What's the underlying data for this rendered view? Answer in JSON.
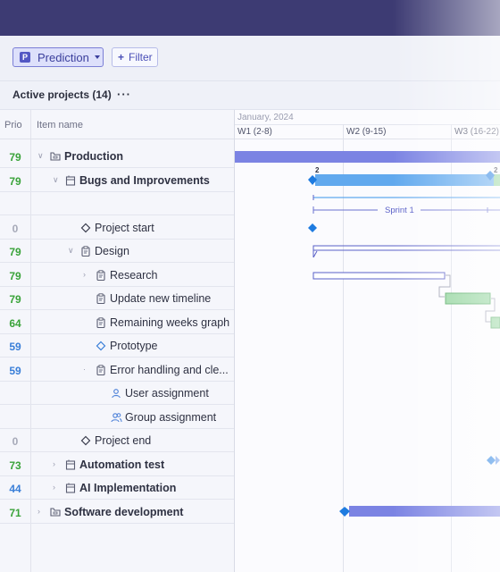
{
  "toolbar": {
    "prediction_label": "Prediction",
    "filter_label": "Filter"
  },
  "projects": {
    "title": "Active projects (14)",
    "more": "···"
  },
  "columns": {
    "prio": "Prio",
    "item_name": "Item name"
  },
  "timeline": {
    "month": "January, 2024",
    "weeks": [
      "W1 (2-8)",
      "W2 (9-15)",
      "W3 (16-22)"
    ],
    "sprint_label": "Sprint 1",
    "badge_a": "2",
    "badge_b": "2"
  },
  "rows": [
    {
      "prio": "79",
      "name": "Production"
    },
    {
      "prio": "79",
      "name": "Bugs and Improvements"
    },
    {
      "prio": "",
      "name": ""
    },
    {
      "prio": "0",
      "name": "Project start"
    },
    {
      "prio": "79",
      "name": "Design"
    },
    {
      "prio": "79",
      "name": "Research"
    },
    {
      "prio": "79",
      "name": "Update new timeline"
    },
    {
      "prio": "64",
      "name": "Remaining weeks graph"
    },
    {
      "prio": "59",
      "name": "Prototype"
    },
    {
      "prio": "59",
      "name": "Error handling and cle..."
    },
    {
      "prio": "",
      "name": "User assignment"
    },
    {
      "prio": "",
      "name": "Group assignment"
    },
    {
      "prio": "0",
      "name": "Project end"
    },
    {
      "prio": "73",
      "name": "Automation test"
    },
    {
      "prio": "44",
      "name": "AI Implementation"
    },
    {
      "prio": "71",
      "name": "Software development"
    }
  ],
  "colors": {
    "green": "#3aa33a",
    "blue": "#3a7fd8",
    "gray": "#a6a9b8",
    "bar_purple": "#7b83e3",
    "bar_blue": "#61a9ee",
    "bar_green": "#8fd39a"
  }
}
